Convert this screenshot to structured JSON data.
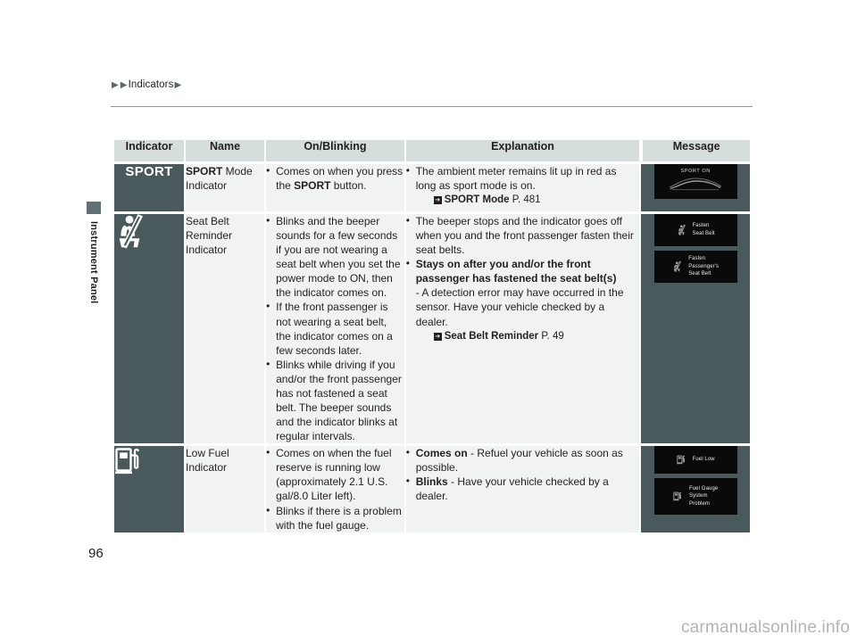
{
  "breadcrumb": {
    "text": "Indicators"
  },
  "sidebar": {
    "section_label": "Instrument Panel"
  },
  "page_number": "96",
  "watermark": "carmanualsonline.info",
  "table": {
    "headers": [
      "Indicator",
      "Name",
      "On/Blinking",
      "Explanation",
      "Message"
    ],
    "rows": [
      {
        "indicator_icon": "sport-mode-indicator-icon",
        "indicator_label": "SPORT",
        "name_bold": "SPORT",
        "name_rest": " Mode",
        "name_line2": "Indicator",
        "on_blinking": [
          {
            "text_parts": [
              {
                "t": "Comes on when you press the ",
                "bold": false
              },
              {
                "t": "SPORT",
                "bold": true
              },
              {
                "t": " button.",
                "bold": false
              }
            ]
          }
        ],
        "explanation": [
          {
            "text_parts": [
              {
                "t": "The ambient meter remains lit up in red as long as sport mode is on.",
                "bold": false
              }
            ],
            "reference": {
              "glyph": "page-reference-icon",
              "title": "SPORT Mode",
              "page": "P. 481"
            }
          }
        ],
        "messages": [
          {
            "icon": "car-silhouette-icon",
            "lines": [
              "SPORT ON"
            ]
          }
        ]
      },
      {
        "indicator_icon": "seat-belt-reminder-icon",
        "indicator_label": "",
        "name_bold": "",
        "name_rest": "Seat Belt",
        "name_line2": "Reminder",
        "name_line3": "Indicator",
        "on_blinking": [
          {
            "text_parts": [
              {
                "t": "Blinks and the beeper sounds for a few seconds if you are not wearing a seat belt when you set the power mode to ON, then the indicator comes on.",
                "bold": false
              }
            ]
          },
          {
            "text_parts": [
              {
                "t": "If the front passenger is not wearing a seat belt, the indicator comes on a few seconds later.",
                "bold": false
              }
            ]
          },
          {
            "text_parts": [
              {
                "t": "Blinks while driving if you and/or the front passenger has not fastened a seat belt. The beeper sounds and the indicator blinks at regular intervals.",
                "bold": false
              }
            ]
          }
        ],
        "explanation": [
          {
            "text_parts": [
              {
                "t": "The beeper stops and the indicator goes off when you and the front passenger fasten their seat belts.",
                "bold": false
              }
            ]
          },
          {
            "text_parts": [
              {
                "t": "Stays on after you and/or the front passenger has fastened the seat belt(s)",
                "bold": true
              }
            ],
            "subtext": "- A detection error may have occurred in the sensor. Have your vehicle checked by a dealer.",
            "reference": {
              "glyph": "page-reference-icon",
              "title": "Seat Belt Reminder",
              "page": "P. 49"
            }
          }
        ],
        "messages": [
          {
            "icon": "seat-belt-reminder-icon",
            "lines": [
              "Fasten",
              "Seat Belt"
            ]
          },
          {
            "icon": "seat-belt-reminder-icon",
            "lines": [
              "Fasten",
              "Passenger's",
              "Seat Belt"
            ]
          }
        ]
      },
      {
        "indicator_icon": "low-fuel-indicator-icon",
        "indicator_label": "",
        "name_bold": "",
        "name_rest": "Low Fuel",
        "name_line2": "Indicator",
        "on_blinking": [
          {
            "text_parts": [
              {
                "t": "Comes on when the fuel reserve is running low (approximately 2.1 U.S. gal/8.0 Liter left).",
                "bold": false
              }
            ]
          },
          {
            "text_parts": [
              {
                "t": "Blinks if there is a problem with the fuel gauge.",
                "bold": false
              }
            ]
          }
        ],
        "explanation": [
          {
            "text_parts": [
              {
                "t": "Comes on",
                "bold": true
              },
              {
                "t": " - Refuel your vehicle as soon as possible.",
                "bold": false
              }
            ]
          },
          {
            "text_parts": [
              {
                "t": "Blinks",
                "bold": true
              },
              {
                "t": " - Have your vehicle checked by a dealer.",
                "bold": false
              }
            ]
          }
        ],
        "messages": [
          {
            "icon": "fuel-pump-icon",
            "lines": [
              "Fuel Low"
            ]
          },
          {
            "icon": "fuel-pump-icon",
            "lines": [
              "Fuel Gauge",
              "System",
              "Problem"
            ]
          }
        ]
      }
    ]
  },
  "colors": {
    "header_bg": "#d6dddd",
    "cell_bg": "#f1f2f2",
    "dark_panel": "#4a5a5c",
    "screen_bg": "#0a0a0a",
    "text": "#231f20"
  }
}
